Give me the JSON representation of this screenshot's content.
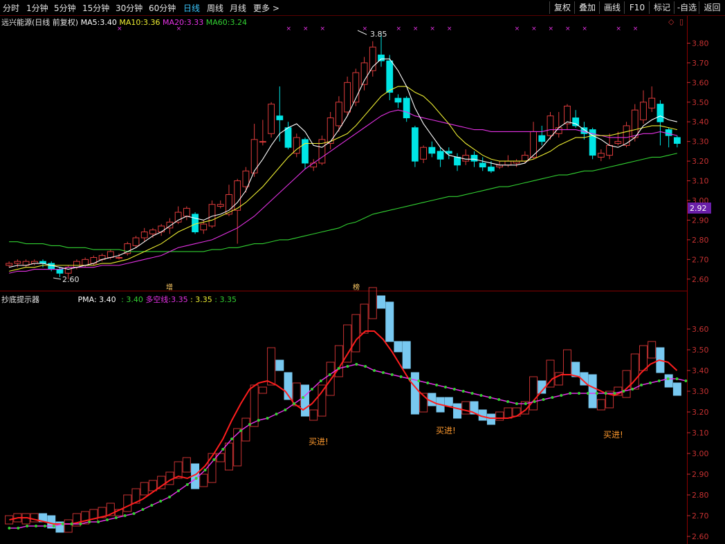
{
  "toolbar": {
    "periods": [
      "分时",
      "1分钟",
      "5分钟",
      "15分钟",
      "30分钟",
      "60分钟",
      "日线",
      "周线",
      "月线",
      "更多 >"
    ],
    "active_period": "日线",
    "right_buttons": [
      "复权",
      "叠加",
      "画线",
      "F10",
      "标记",
      "-自选",
      "返回"
    ]
  },
  "main_panel": {
    "stock_name": "远兴能源(日线 前复权)",
    "ma5_label": "MA5:",
    "ma5_value": "3.40",
    "ma10_label": "MA10:",
    "ma10_value": "3.36",
    "ma20_label": "MA20:",
    "ma20_value": "3.33",
    "ma60_label": "MA60:",
    "ma60_value": "3.24",
    "high_marker": "3.85",
    "low_marker": "2.60",
    "current_price_tag": "2.92",
    "tag_zeng": "增",
    "tag_bang": "榜",
    "y_ticks": [
      "3.80",
      "3.70",
      "3.60",
      "3.50",
      "3.40",
      "3.30",
      "3.20",
      "3.10",
      "3.00",
      "2.90",
      "2.80",
      "2.70",
      "2.60"
    ]
  },
  "sub_panel": {
    "indicator_name": "抄底提示器",
    "pma_label": "PMA:",
    "pma_value": "3.40",
    "second_value": ": 3.40",
    "multi_label": "多空线:",
    "multi_value": "3.35",
    "v4": ": 3.35",
    "v5": ": 3.35",
    "buy_signals": [
      "买进!",
      "买进!",
      "买进!"
    ],
    "y_ticks": [
      "3.60",
      "3.50",
      "3.40",
      "3.30",
      "3.20",
      "3.10",
      "3.00",
      "2.90",
      "2.80",
      "2.70",
      "2.60"
    ]
  },
  "colors": {
    "up": "#e03c3c",
    "down": "#00e5e5",
    "ma5": "#ffffff",
    "ma10": "#f0f032",
    "ma20": "#e632e6",
    "ma60": "#32d232",
    "axis": "#c83232",
    "price_tag_bg": "#6a1fa8"
  },
  "chart_data": {
    "type": "candlestick",
    "main": {
      "y_range": [
        2.55,
        3.9
      ],
      "candles": [
        [
          2.67,
          2.68,
          2.66,
          2.69
        ],
        [
          2.68,
          2.69,
          2.66,
          2.7
        ],
        [
          2.67,
          2.69,
          2.66,
          2.7
        ],
        [
          2.68,
          2.69,
          2.67,
          2.7
        ],
        [
          2.69,
          2.68,
          2.66,
          2.7
        ],
        [
          2.68,
          2.65,
          2.64,
          2.69
        ],
        [
          2.65,
          2.63,
          2.61,
          2.66
        ],
        [
          2.63,
          2.66,
          2.6,
          2.67
        ],
        [
          2.66,
          2.69,
          2.65,
          2.7
        ],
        [
          2.67,
          2.7,
          2.66,
          2.71
        ],
        [
          2.68,
          2.71,
          2.67,
          2.72
        ],
        [
          2.7,
          2.72,
          2.69,
          2.73
        ],
        [
          2.71,
          2.74,
          2.7,
          2.75
        ],
        [
          2.71,
          2.71,
          2.7,
          2.73
        ],
        [
          2.73,
          2.78,
          2.72,
          2.79
        ],
        [
          2.77,
          2.81,
          2.76,
          2.82
        ],
        [
          2.81,
          2.84,
          2.79,
          2.86
        ],
        [
          2.83,
          2.85,
          2.81,
          2.86
        ],
        [
          2.84,
          2.87,
          2.82,
          2.88
        ],
        [
          2.86,
          2.89,
          2.83,
          2.91
        ],
        [
          2.89,
          2.94,
          2.88,
          2.97
        ],
        [
          2.92,
          2.96,
          2.9,
          2.97
        ],
        [
          2.93,
          2.84,
          2.83,
          2.94
        ],
        [
          2.85,
          2.88,
          2.83,
          2.9
        ],
        [
          2.87,
          2.98,
          2.86,
          3.0
        ],
        [
          2.97,
          2.98,
          2.96,
          3.0
        ],
        [
          2.93,
          3.03,
          2.92,
          3.08
        ],
        [
          2.95,
          3.1,
          2.78,
          3.11
        ],
        [
          3.07,
          3.15,
          3.04,
          3.17
        ],
        [
          3.14,
          3.31,
          3.12,
          3.39
        ],
        [
          3.3,
          3.3,
          3.28,
          3.41
        ],
        [
          3.34,
          3.49,
          3.32,
          3.5
        ],
        [
          3.43,
          3.41,
          3.3,
          3.58
        ],
        [
          3.37,
          3.27,
          3.26,
          3.4
        ],
        [
          3.24,
          3.32,
          3.22,
          3.34
        ],
        [
          3.31,
          3.19,
          3.16,
          3.32
        ],
        [
          3.17,
          3.19,
          3.15,
          3.21
        ],
        [
          3.19,
          3.31,
          3.18,
          3.33
        ],
        [
          3.29,
          3.42,
          3.26,
          3.45
        ],
        [
          3.38,
          3.5,
          3.35,
          3.53
        ],
        [
          3.45,
          3.6,
          3.43,
          3.63
        ],
        [
          3.5,
          3.65,
          3.48,
          3.67
        ],
        [
          3.59,
          3.7,
          3.56,
          3.73
        ],
        [
          3.66,
          3.78,
          3.63,
          3.81
        ],
        [
          3.74,
          3.71,
          3.68,
          3.85
        ],
        [
          3.71,
          3.55,
          3.51,
          3.74
        ],
        [
          3.52,
          3.5,
          3.47,
          3.54
        ],
        [
          3.52,
          3.42,
          3.4,
          3.53
        ],
        [
          3.37,
          3.2,
          3.17,
          3.38
        ],
        [
          3.21,
          3.27,
          3.19,
          3.28
        ],
        [
          3.27,
          3.24,
          3.22,
          3.3
        ],
        [
          3.25,
          3.21,
          3.17,
          3.27
        ],
        [
          3.25,
          3.24,
          3.21,
          3.27
        ],
        [
          3.22,
          3.18,
          3.15,
          3.24
        ],
        [
          3.2,
          3.23,
          3.18,
          3.26
        ],
        [
          3.23,
          3.2,
          3.17,
          3.25
        ],
        [
          3.19,
          3.17,
          3.15,
          3.22
        ],
        [
          3.17,
          3.15,
          3.14,
          3.2
        ],
        [
          3.17,
          3.18,
          3.16,
          3.2
        ],
        [
          3.18,
          3.2,
          3.17,
          3.23
        ],
        [
          3.19,
          3.2,
          3.17,
          3.21
        ],
        [
          3.2,
          3.23,
          3.19,
          3.25
        ],
        [
          3.22,
          3.35,
          3.21,
          3.4
        ],
        [
          3.33,
          3.3,
          3.28,
          3.38
        ],
        [
          3.33,
          3.43,
          3.31,
          3.45
        ],
        [
          3.34,
          3.37,
          3.32,
          3.45
        ],
        [
          3.39,
          3.48,
          3.36,
          3.49
        ],
        [
          3.42,
          3.38,
          3.37,
          3.46
        ],
        [
          3.37,
          3.34,
          3.31,
          3.4
        ],
        [
          3.36,
          3.23,
          3.21,
          3.37
        ],
        [
          3.22,
          3.24,
          3.2,
          3.26
        ],
        [
          3.23,
          3.28,
          3.21,
          3.34
        ],
        [
          3.29,
          3.3,
          3.28,
          3.35
        ],
        [
          3.28,
          3.38,
          3.27,
          3.4
        ],
        [
          3.32,
          3.46,
          3.3,
          3.49
        ],
        [
          3.41,
          3.5,
          3.39,
          3.56
        ],
        [
          3.47,
          3.52,
          3.45,
          3.58
        ],
        [
          3.49,
          3.4,
          3.28,
          3.51
        ],
        [
          3.36,
          3.33,
          3.27,
          3.37
        ],
        [
          3.32,
          3.29,
          3.27,
          3.33
        ]
      ],
      "ma5": [
        2.66,
        2.67,
        2.67,
        2.68,
        2.68,
        2.67,
        2.66,
        2.65,
        2.66,
        2.67,
        2.68,
        2.7,
        2.71,
        2.72,
        2.74,
        2.76,
        2.79,
        2.82,
        2.84,
        2.87,
        2.9,
        2.92,
        2.91,
        2.9,
        2.92,
        2.93,
        2.95,
        2.99,
        3.05,
        3.15,
        3.21,
        3.28,
        3.34,
        3.37,
        3.39,
        3.35,
        3.28,
        3.27,
        3.3,
        3.36,
        3.43,
        3.52,
        3.61,
        3.68,
        3.72,
        3.72,
        3.66,
        3.58,
        3.47,
        3.39,
        3.33,
        3.27,
        3.23,
        3.22,
        3.21,
        3.21,
        3.2,
        3.19,
        3.18,
        3.18,
        3.18,
        3.19,
        3.23,
        3.27,
        3.32,
        3.37,
        3.4,
        3.39,
        3.36,
        3.33,
        3.31,
        3.28,
        3.27,
        3.29,
        3.32,
        3.38,
        3.41,
        3.43,
        3.41,
        3.4
      ],
      "ma10": [
        2.64,
        2.65,
        2.66,
        2.66,
        2.67,
        2.67,
        2.67,
        2.67,
        2.67,
        2.67,
        2.67,
        2.68,
        2.68,
        2.69,
        2.7,
        2.72,
        2.74,
        2.76,
        2.78,
        2.81,
        2.84,
        2.86,
        2.88,
        2.89,
        2.9,
        2.92,
        2.94,
        2.96,
        2.99,
        3.03,
        3.07,
        3.12,
        3.17,
        3.22,
        3.26,
        3.29,
        3.29,
        3.29,
        3.3,
        3.32,
        3.34,
        3.38,
        3.43,
        3.48,
        3.53,
        3.56,
        3.58,
        3.58,
        3.55,
        3.53,
        3.49,
        3.44,
        3.39,
        3.33,
        3.29,
        3.26,
        3.23,
        3.21,
        3.2,
        3.2,
        3.2,
        3.2,
        3.21,
        3.23,
        3.25,
        3.28,
        3.3,
        3.32,
        3.32,
        3.33,
        3.33,
        3.33,
        3.34,
        3.35,
        3.36,
        3.37,
        3.38,
        3.38,
        3.37,
        3.36
      ],
      "ma20": [
        2.63,
        2.64,
        2.64,
        2.65,
        2.65,
        2.65,
        2.65,
        2.66,
        2.66,
        2.66,
        2.66,
        2.67,
        2.67,
        2.67,
        2.68,
        2.69,
        2.7,
        2.71,
        2.72,
        2.74,
        2.76,
        2.77,
        2.78,
        2.79,
        2.8,
        2.82,
        2.84,
        2.86,
        2.89,
        2.92,
        2.96,
        3.0,
        3.04,
        3.08,
        3.12,
        3.16,
        3.19,
        3.22,
        3.25,
        3.28,
        3.31,
        3.34,
        3.37,
        3.4,
        3.43,
        3.45,
        3.46,
        3.45,
        3.43,
        3.42,
        3.41,
        3.4,
        3.39,
        3.38,
        3.37,
        3.36,
        3.36,
        3.35,
        3.35,
        3.35,
        3.35,
        3.35,
        3.35,
        3.35,
        3.36,
        3.36,
        3.36,
        3.36,
        3.35,
        3.34,
        3.33,
        3.32,
        3.32,
        3.32,
        3.33,
        3.34,
        3.34,
        3.35,
        3.34,
        3.33
      ],
      "ma60": [
        2.79,
        2.79,
        2.78,
        2.78,
        2.78,
        2.77,
        2.77,
        2.76,
        2.76,
        2.76,
        2.75,
        2.75,
        2.75,
        2.75,
        2.74,
        2.74,
        2.74,
        2.74,
        2.74,
        2.74,
        2.74,
        2.74,
        2.74,
        2.74,
        2.75,
        2.75,
        2.76,
        2.76,
        2.77,
        2.78,
        2.78,
        2.79,
        2.8,
        2.8,
        2.81,
        2.82,
        2.83,
        2.84,
        2.85,
        2.86,
        2.88,
        2.89,
        2.91,
        2.93,
        2.94,
        2.95,
        2.96,
        2.97,
        2.98,
        2.99,
        3.0,
        3.01,
        3.02,
        3.02,
        3.03,
        3.04,
        3.05,
        3.06,
        3.07,
        3.07,
        3.08,
        3.09,
        3.1,
        3.11,
        3.12,
        3.13,
        3.13,
        3.14,
        3.15,
        3.15,
        3.16,
        3.17,
        3.18,
        3.19,
        3.2,
        3.21,
        3.22,
        3.22,
        3.23,
        3.24
      ]
    },
    "sub": {
      "y_range": [
        2.57,
        3.72
      ],
      "pma": [
        2.68,
        2.69,
        2.69,
        2.68,
        2.67,
        2.66,
        2.66,
        2.66,
        2.67,
        2.68,
        2.69,
        2.7,
        2.72,
        2.74,
        2.76,
        2.78,
        2.81,
        2.84,
        2.87,
        2.89,
        2.88,
        2.9,
        2.94,
        3.0,
        3.07,
        3.16,
        3.24,
        3.31,
        3.34,
        3.35,
        3.33,
        3.3,
        3.24,
        3.21,
        3.24,
        3.29,
        3.35,
        3.41,
        3.48,
        3.55,
        3.59,
        3.59,
        3.55,
        3.49,
        3.42,
        3.35,
        3.3,
        3.26,
        3.24,
        3.23,
        3.22,
        3.21,
        3.2,
        3.18,
        3.17,
        3.17,
        3.17,
        3.18,
        3.21,
        3.26,
        3.31,
        3.36,
        3.38,
        3.38,
        3.37,
        3.33,
        3.31,
        3.29,
        3.28,
        3.3,
        3.34,
        3.39,
        3.43,
        3.45,
        3.44,
        3.4
      ],
      "multi": [
        2.64,
        2.64,
        2.65,
        2.65,
        2.65,
        2.65,
        2.66,
        2.66,
        2.66,
        2.67,
        2.67,
        2.68,
        2.69,
        2.7,
        2.71,
        2.73,
        2.75,
        2.77,
        2.79,
        2.82,
        2.85,
        2.88,
        2.92,
        2.97,
        3.02,
        3.07,
        3.11,
        3.14,
        3.16,
        3.17,
        3.19,
        3.21,
        3.24,
        3.27,
        3.31,
        3.35,
        3.38,
        3.41,
        3.42,
        3.43,
        3.42,
        3.4,
        3.39,
        3.38,
        3.37,
        3.36,
        3.35,
        3.34,
        3.33,
        3.32,
        3.31,
        3.3,
        3.29,
        3.28,
        3.27,
        3.26,
        3.25,
        3.24,
        3.24,
        3.25,
        3.26,
        3.27,
        3.28,
        3.29,
        3.29,
        3.29,
        3.29,
        3.29,
        3.29,
        3.3,
        3.31,
        3.33,
        3.34,
        3.35,
        3.36,
        3.36,
        3.35
      ]
    }
  }
}
